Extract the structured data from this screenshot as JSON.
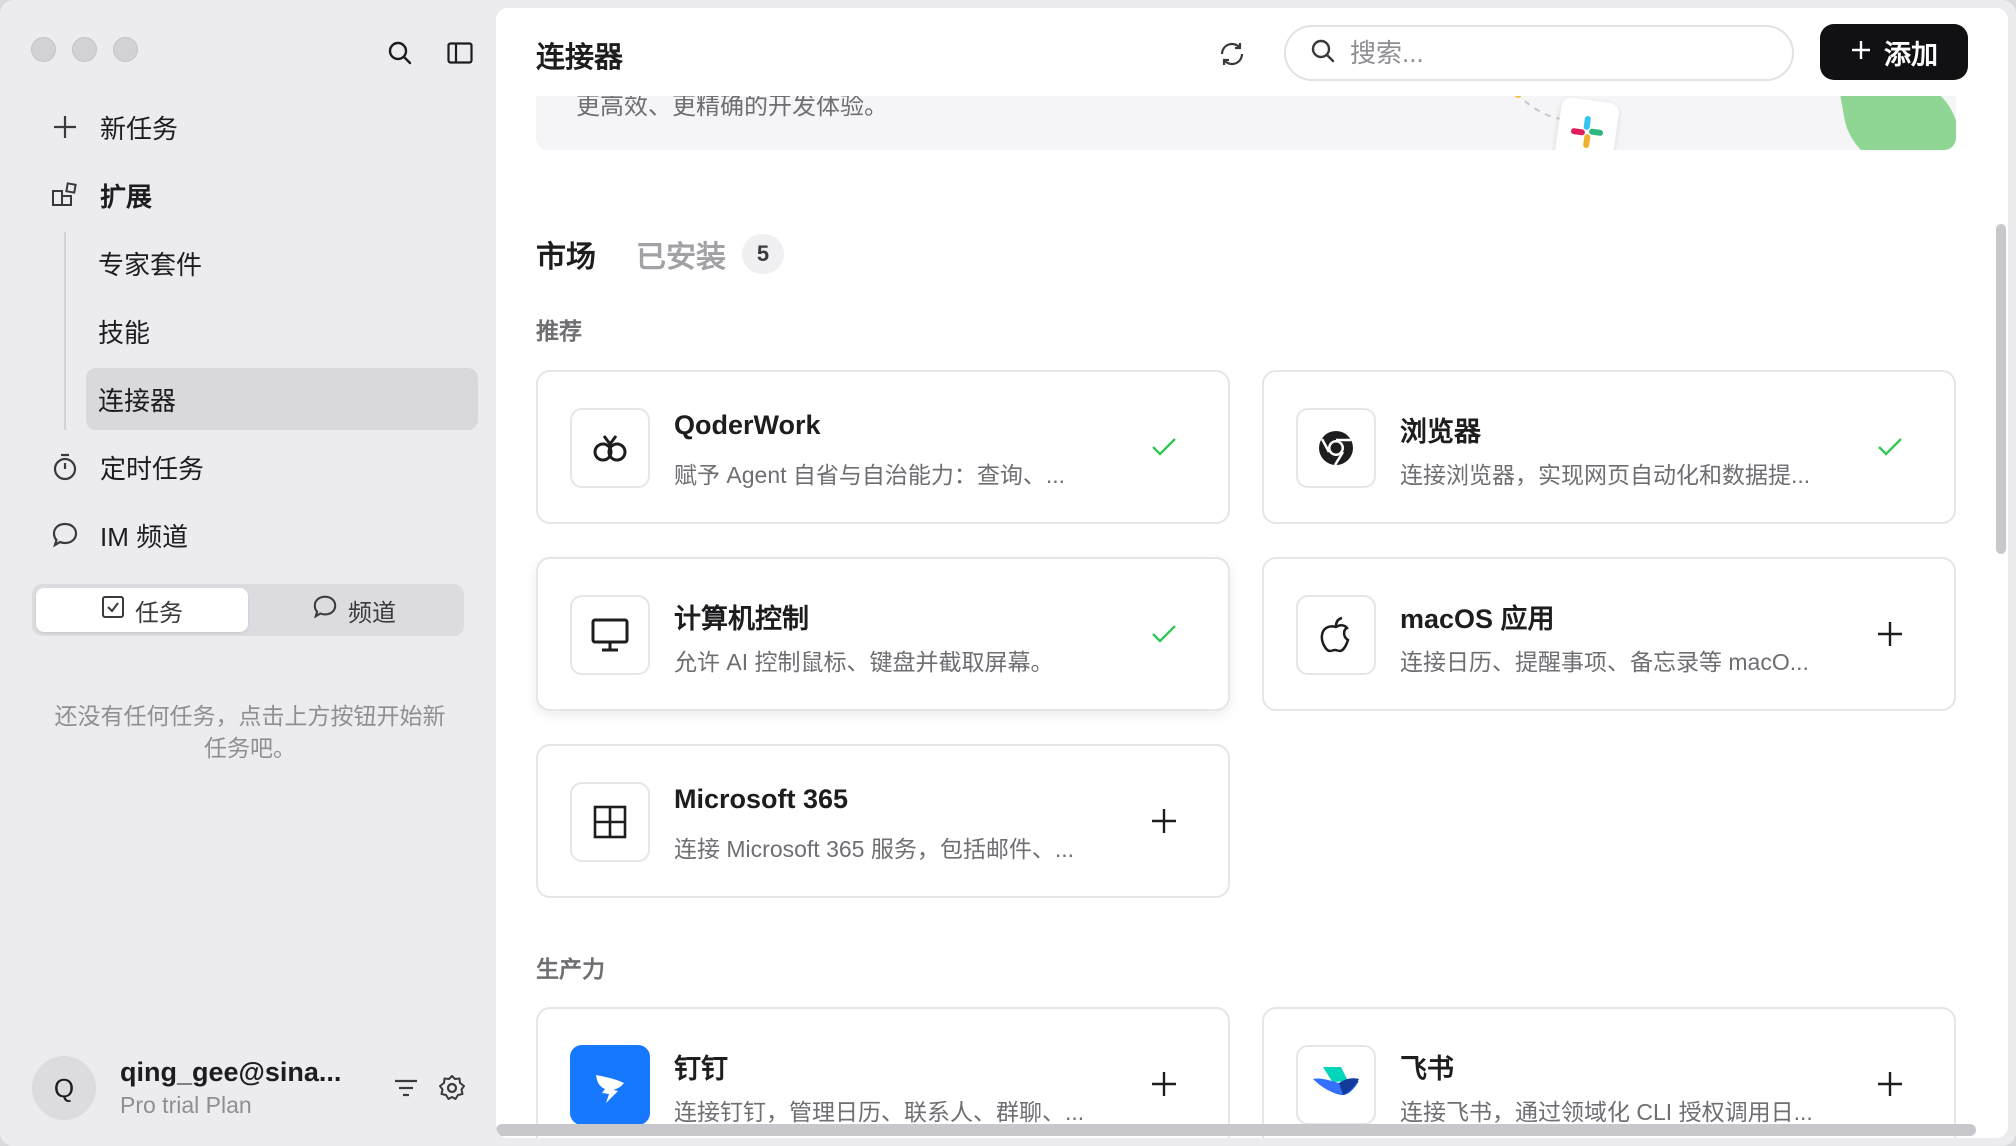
{
  "sidebar": {
    "nav": [
      {
        "label": "新任务",
        "icon": "plus-icon"
      },
      {
        "label": "扩展",
        "icon": "extension-icon"
      }
    ],
    "sub": [
      {
        "label": "专家套件"
      },
      {
        "label": "技能"
      },
      {
        "label": "连接器",
        "active": true
      }
    ],
    "nav2": [
      {
        "label": "定时任务",
        "icon": "timer-icon"
      },
      {
        "label": "IM 频道",
        "icon": "chat-bubble-icon"
      }
    ],
    "segment": {
      "tasks": "任务",
      "channels": "频道"
    },
    "empty_message": "还没有任何任务，点击上方按钮开始新任务吧。",
    "user": {
      "initial": "Q",
      "name": "qing_gee@sina...",
      "plan": "Pro trial Plan"
    }
  },
  "header": {
    "title": "连接器",
    "search_placeholder": "搜索...",
    "add_label": "添加"
  },
  "banner": {
    "text": "更高效、更精确的开发体验。"
  },
  "tabs": {
    "market": "市场",
    "installed": "已安装",
    "installed_count": "5"
  },
  "sections": {
    "recommended": "推荐",
    "productivity": "生产力"
  },
  "recommended": [
    {
      "name": "QoderWork",
      "desc": "赋予 Agent 自省与自治能力：查询、...",
      "icon": "qoderwork-logo-icon",
      "status": "installed"
    },
    {
      "name": "浏览器",
      "desc": "连接浏览器，实现网页自动化和数据提...",
      "icon": "chrome-logo-icon",
      "status": "installed"
    },
    {
      "name": "计算机控制",
      "desc": "允许 AI 控制鼠标、键盘并截取屏幕。",
      "icon": "monitor-icon",
      "status": "installed"
    },
    {
      "name": "macOS 应用",
      "desc": "连接日历、提醒事项、备忘录等 macO...",
      "icon": "apple-logo-icon",
      "status": "add"
    },
    {
      "name": "Microsoft 365",
      "desc": "连接 Microsoft 365 服务，包括邮件、...",
      "icon": "microsoft-grid-icon",
      "status": "add"
    }
  ],
  "productivity": [
    {
      "name": "钉钉",
      "desc": "连接钉钉，管理日历、联系人、群聊、...",
      "icon": "dingtalk-logo-icon",
      "status": "add"
    },
    {
      "name": "飞书",
      "desc": "连接飞书，通过领域化 CLI 授权调用日...",
      "icon": "feishu-logo-icon",
      "status": "add"
    }
  ],
  "colors": {
    "accent_check": "#34c759",
    "dingtalk": "#1677ff",
    "add_button": "#111113"
  }
}
